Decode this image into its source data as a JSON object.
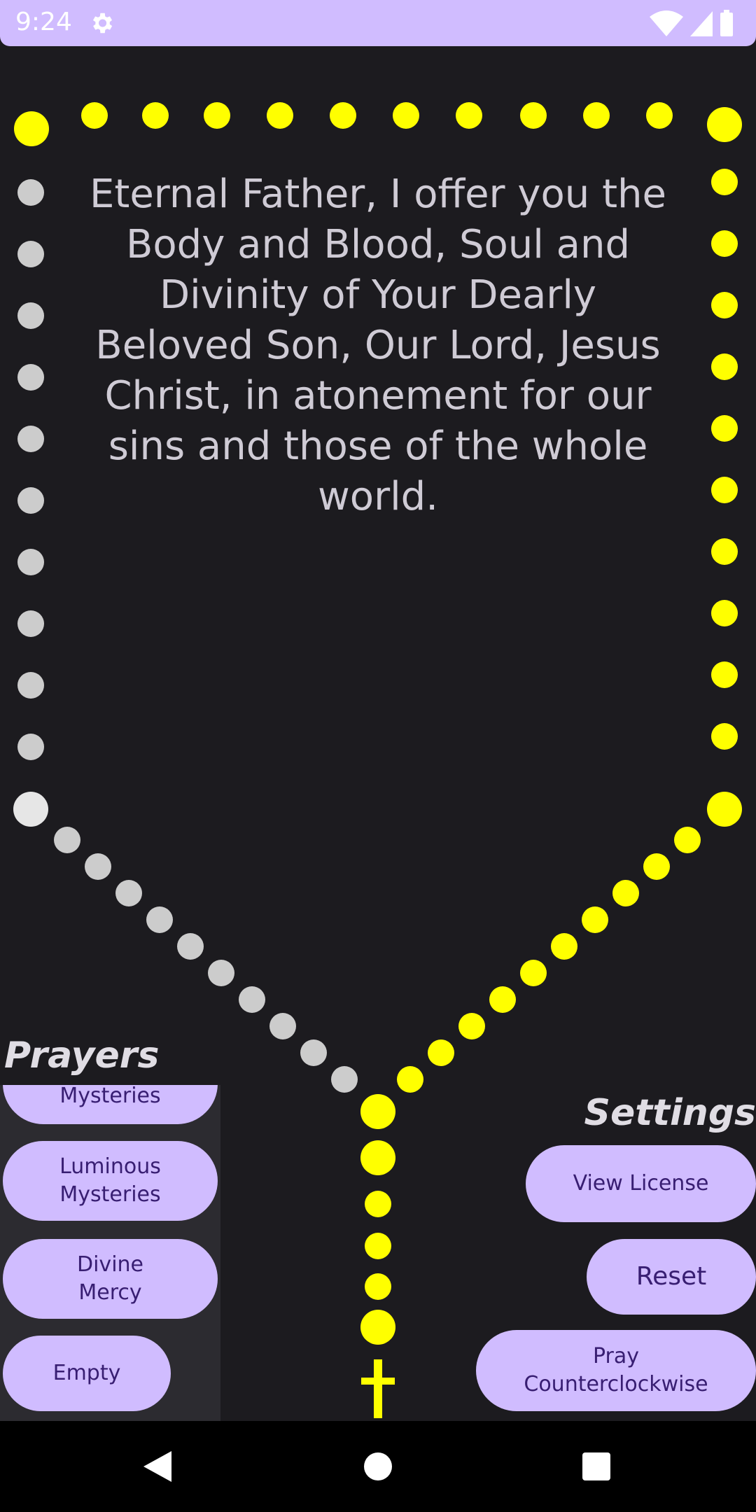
{
  "status_bar": {
    "time": "9:24",
    "icons": [
      "gear-icon",
      "wifi-icon",
      "signal-icon",
      "battery-icon"
    ]
  },
  "prayer": {
    "text": "Eternal Father, I offer you the Body and Blood, Soul and Divinity of Your Dearly Beloved Son, Our Lord, Jesus Christ, in atonement for our sins and those of the whole world."
  },
  "rosary": {
    "active_color": "#ffff00",
    "inactive_color": "#cccccc",
    "crucifix_color": "#ffff00"
  },
  "prayers_panel": {
    "heading": "Prayers",
    "items": [
      {
        "label": "Mysteries"
      },
      {
        "label": "Luminous Mysteries"
      },
      {
        "label": "Divine Mercy"
      },
      {
        "label": "Empty"
      }
    ]
  },
  "settings_panel": {
    "heading": "Settings",
    "items": [
      {
        "label": "View License"
      },
      {
        "label": "Reset"
      },
      {
        "label": "Pray Counterclockwise"
      }
    ]
  },
  "nav_bar": {
    "buttons": [
      "back-icon",
      "home-icon",
      "recents-icon"
    ]
  },
  "colors": {
    "background": "#1c1b1f",
    "accent": "#d0bcff",
    "button_text": "#381e72",
    "prayer_text": "#cfcbd5"
  }
}
